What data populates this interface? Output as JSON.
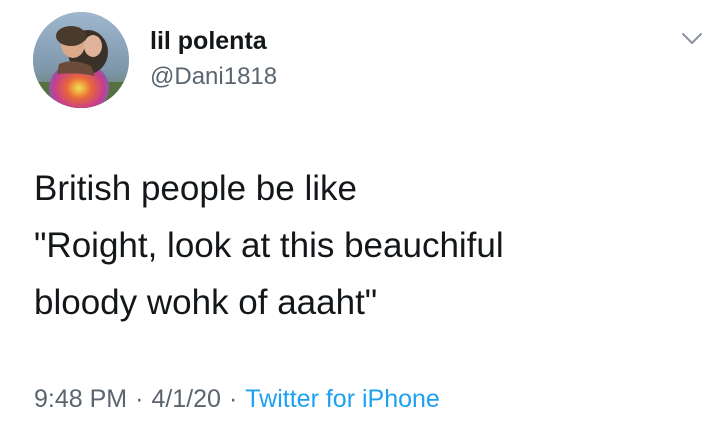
{
  "tweet": {
    "display_name": "lil polenta",
    "handle": "@Dani1818",
    "text_lines": [
      "British people be like",
      "\"Roight, look at this beauchiful",
      "bloody wohk of aaaht\""
    ],
    "time": "9:48 PM",
    "separator": "·",
    "date": "4/1/20",
    "source": "Twitter for iPhone",
    "menu_icon": "chevron-down-icon",
    "avatar_icon": "avatar-photo"
  },
  "colors": {
    "text": "#14171a",
    "secondary": "#5b6570",
    "link": "#1da1f2",
    "background": "#ffffff"
  }
}
